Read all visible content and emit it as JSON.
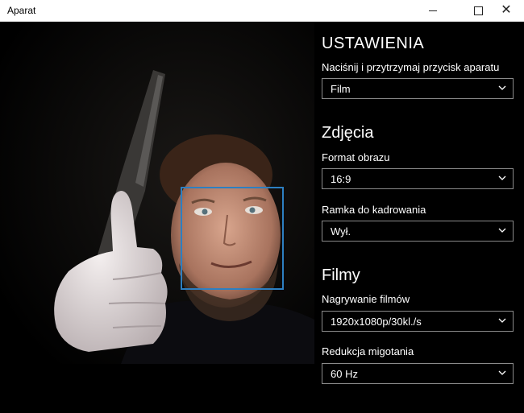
{
  "window": {
    "title": "Aparat",
    "controls": {
      "minimize": "minimize-icon",
      "maximize": "maximize-icon",
      "close": "close-icon"
    }
  },
  "preview": {
    "description_icons": [
      "face-detection-box"
    ],
    "accent": "#2d7fc1"
  },
  "settings": {
    "heading": "USTAWIENIA",
    "camera_button": {
      "label": "Naciśnij i przytrzymaj przycisk aparatu",
      "value": "Film"
    },
    "photos": {
      "heading": "Zdjęcia",
      "format": {
        "label": "Format obrazu",
        "value": "16:9"
      },
      "framing": {
        "label": "Ramka do kadrowania",
        "value": "Wył."
      }
    },
    "videos": {
      "heading": "Filmy",
      "recording": {
        "label": "Nagrywanie filmów",
        "value": "1920x1080p/30kl./s"
      },
      "flicker": {
        "label": "Redukcja migotania",
        "value": "60 Hz"
      }
    }
  }
}
